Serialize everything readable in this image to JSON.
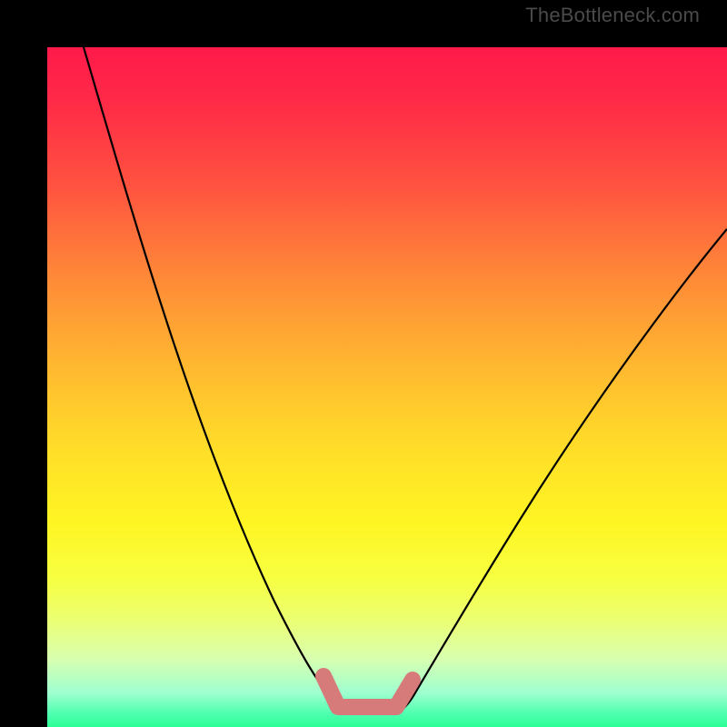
{
  "watermark": {
    "text": "TheBottleneck.com"
  },
  "chart_data": {
    "type": "line",
    "title": "",
    "xlabel": "",
    "ylabel": "",
    "xlim": [
      0,
      100
    ],
    "ylim": [
      0,
      100
    ],
    "series": [
      {
        "name": "bottleneck-curve",
        "x": [
          0,
          5,
          10,
          15,
          20,
          25,
          30,
          35,
          38,
          40,
          42,
          44,
          46,
          48,
          50,
          55,
          60,
          65,
          70,
          75,
          80,
          85,
          90,
          95,
          100
        ],
        "values": [
          100,
          88,
          76,
          64,
          52,
          40,
          28,
          16,
          10,
          6,
          3,
          1,
          0,
          0,
          1,
          4,
          9,
          16,
          24,
          32,
          40,
          48,
          55,
          62,
          68
        ]
      }
    ],
    "annotations": [
      {
        "name": "optimal-marker",
        "x_range": [
          40,
          50
        ],
        "y": 2
      }
    ],
    "colors": {
      "curve": "#000000",
      "marker": "#d77a7a",
      "gradient_top": "#ff1a4a",
      "gradient_bottom": "#2cff96"
    }
  }
}
